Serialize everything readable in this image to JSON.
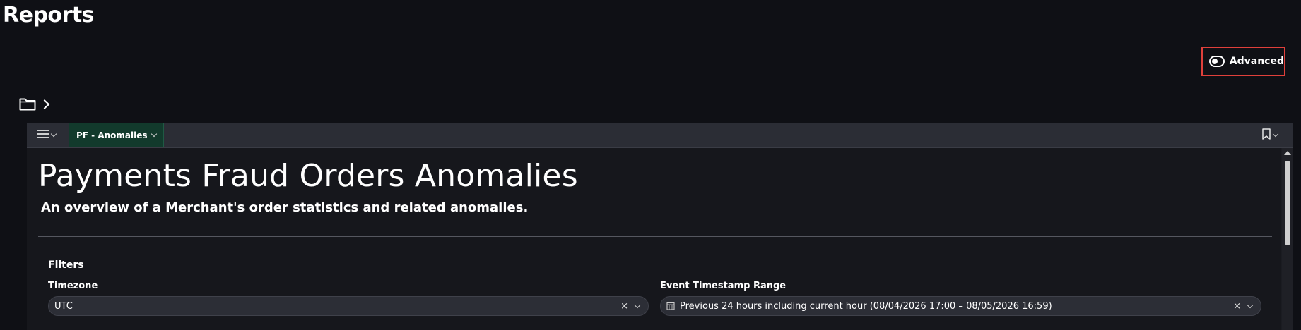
{
  "page": {
    "title": "Reports",
    "advanced_label": "Advanced",
    "advanced_enabled": false
  },
  "breadcrumb": {
    "icons": [
      "folder-icon",
      "chevron-right-icon"
    ]
  },
  "dashboard": {
    "tab_label": "PF - Anomalies",
    "title": "Payments Fraud Orders Anomalies",
    "subtitle": "An overview of a Merchant's order statistics and related anomalies.",
    "filters": {
      "heading": "Filters",
      "timezone": {
        "label": "Timezone",
        "value": "UTC",
        "clear": "×"
      },
      "event_range": {
        "label": "Event Timestamp Range",
        "value": "Previous 24 hours including current hour (08/04/2026 17:00 – 08/05/2026 16:59)",
        "clear": "×"
      }
    }
  },
  "colors": {
    "background": "#0f1015",
    "toolbar": "#2b2d35",
    "active_tab": "#123a2c",
    "highlight_border": "#e0403b"
  }
}
